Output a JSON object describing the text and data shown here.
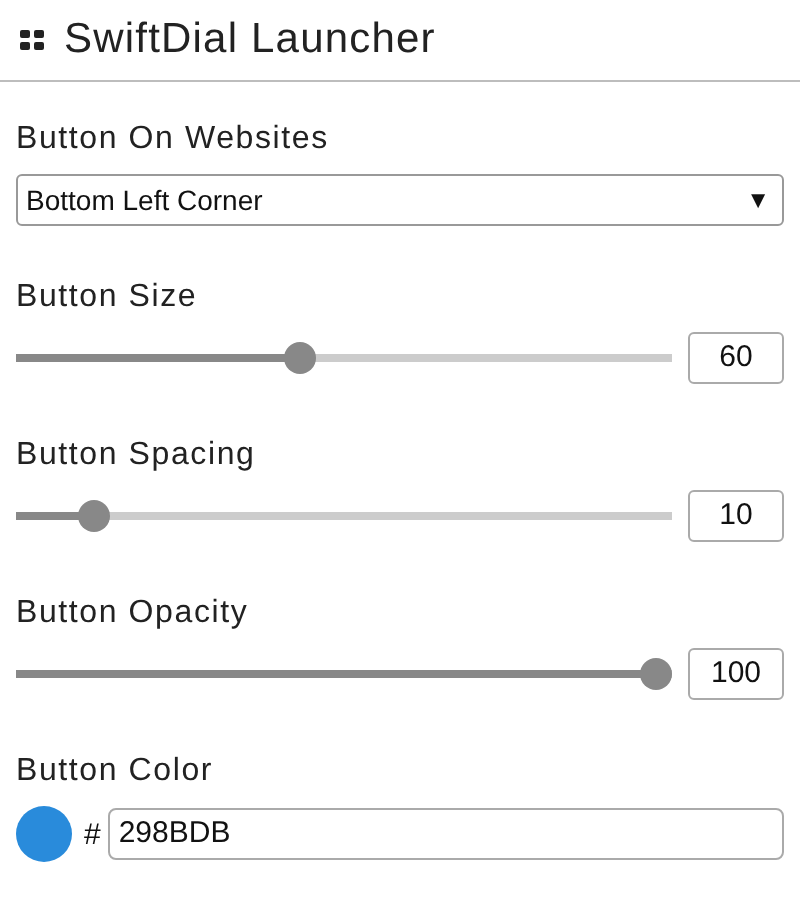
{
  "header": {
    "title": "SwiftDial Launcher"
  },
  "settings": [
    {
      "kind": "select",
      "label": "Button On Websites",
      "value": "Bottom Left Corner",
      "caret": "▼"
    },
    {
      "kind": "slider",
      "label": "Button Size",
      "level": 0.43,
      "value": "60"
    },
    {
      "kind": "slider",
      "label": "Button Spacing",
      "level": 0.1,
      "value": "10"
    },
    {
      "kind": "slider",
      "label": "Button Opacity",
      "level": 1,
      "value": "100"
    },
    {
      "kind": "color",
      "label": "Button Color",
      "color": "#298bdb",
      "prefix": "#",
      "value": "298BDB"
    }
  ]
}
